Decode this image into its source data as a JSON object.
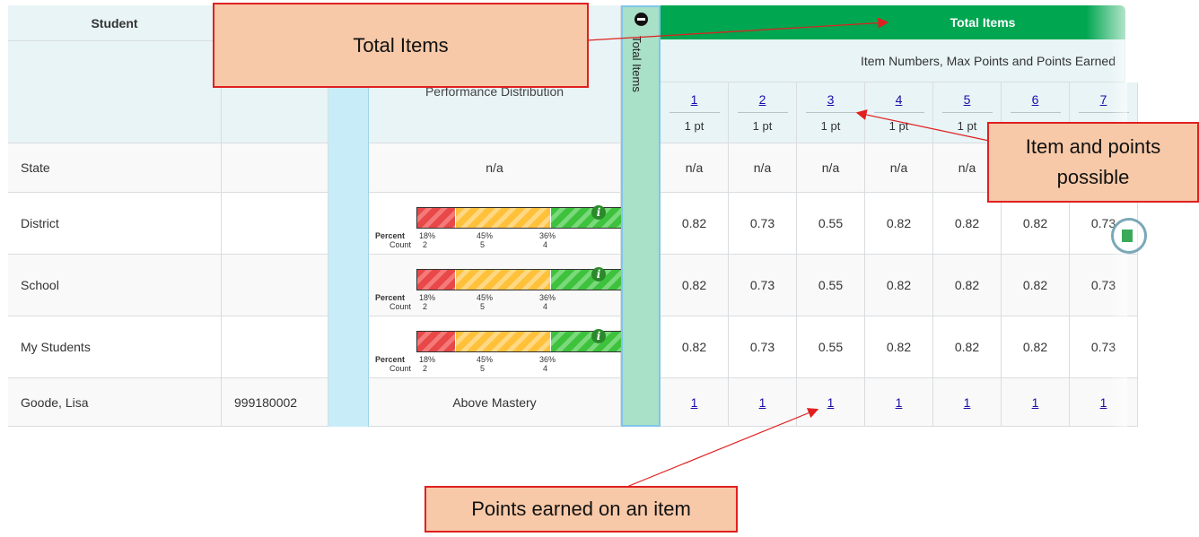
{
  "header": {
    "student_col": "Student",
    "performance_distribution": "Performance Distribution",
    "collapse_label": "Total Items",
    "group_title": "Total Items",
    "subheader": "Item Numbers, Max Points and Points Earned"
  },
  "items": [
    {
      "number": "1",
      "points": "1 pt"
    },
    {
      "number": "2",
      "points": "1 pt"
    },
    {
      "number": "3",
      "points": "1 pt"
    },
    {
      "number": "4",
      "points": "1 pt"
    },
    {
      "number": "5",
      "points": "1 pt"
    },
    {
      "number": "6",
      "points": ""
    },
    {
      "number": "7",
      "points": ""
    }
  ],
  "rows": [
    {
      "label": "State",
      "perf": "n/a",
      "values": [
        "n/a",
        "n/a",
        "n/a",
        "n/a",
        "n/a",
        "",
        ""
      ]
    },
    {
      "label": "District",
      "bar": {
        "percent": [
          "18%",
          "45%",
          "36%"
        ],
        "count": [
          "2",
          "5",
          "4"
        ]
      },
      "values": [
        "0.82",
        "0.73",
        "0.55",
        "0.82",
        "0.82",
        "0.82",
        "0.73"
      ]
    },
    {
      "label": "School",
      "bar": {
        "percent": [
          "18%",
          "45%",
          "36%"
        ],
        "count": [
          "2",
          "5",
          "4"
        ]
      },
      "values": [
        "0.82",
        "0.73",
        "0.55",
        "0.82",
        "0.82",
        "0.82",
        "0.73"
      ]
    },
    {
      "label": "My Students",
      "bar": {
        "percent": [
          "18%",
          "45%",
          "36%"
        ],
        "count": [
          "2",
          "5",
          "4"
        ]
      },
      "values": [
        "0.82",
        "0.73",
        "0.55",
        "0.82",
        "0.82",
        "0.82",
        "0.73"
      ]
    },
    {
      "label": "Goode, Lisa",
      "id": "999180002",
      "perf": "Above Mastery",
      "values": [
        "1",
        "1",
        "1",
        "1",
        "1",
        "1",
        "1"
      ]
    }
  ],
  "bar_labels": {
    "percent": "Percent",
    "count": "Count"
  },
  "distribution": [
    0.18,
    0.45,
    0.36
  ],
  "callouts": {
    "total_items": "Total Items",
    "item_points": "Item and points possible",
    "points_earned": "Points earned on an item"
  },
  "colors": {
    "header_green": "#00a650",
    "collapse_col": "#a8e0c8",
    "blue_col": "#c8ecf8",
    "callout_fill": "#f7c9a8",
    "callout_border": "#e02020"
  }
}
